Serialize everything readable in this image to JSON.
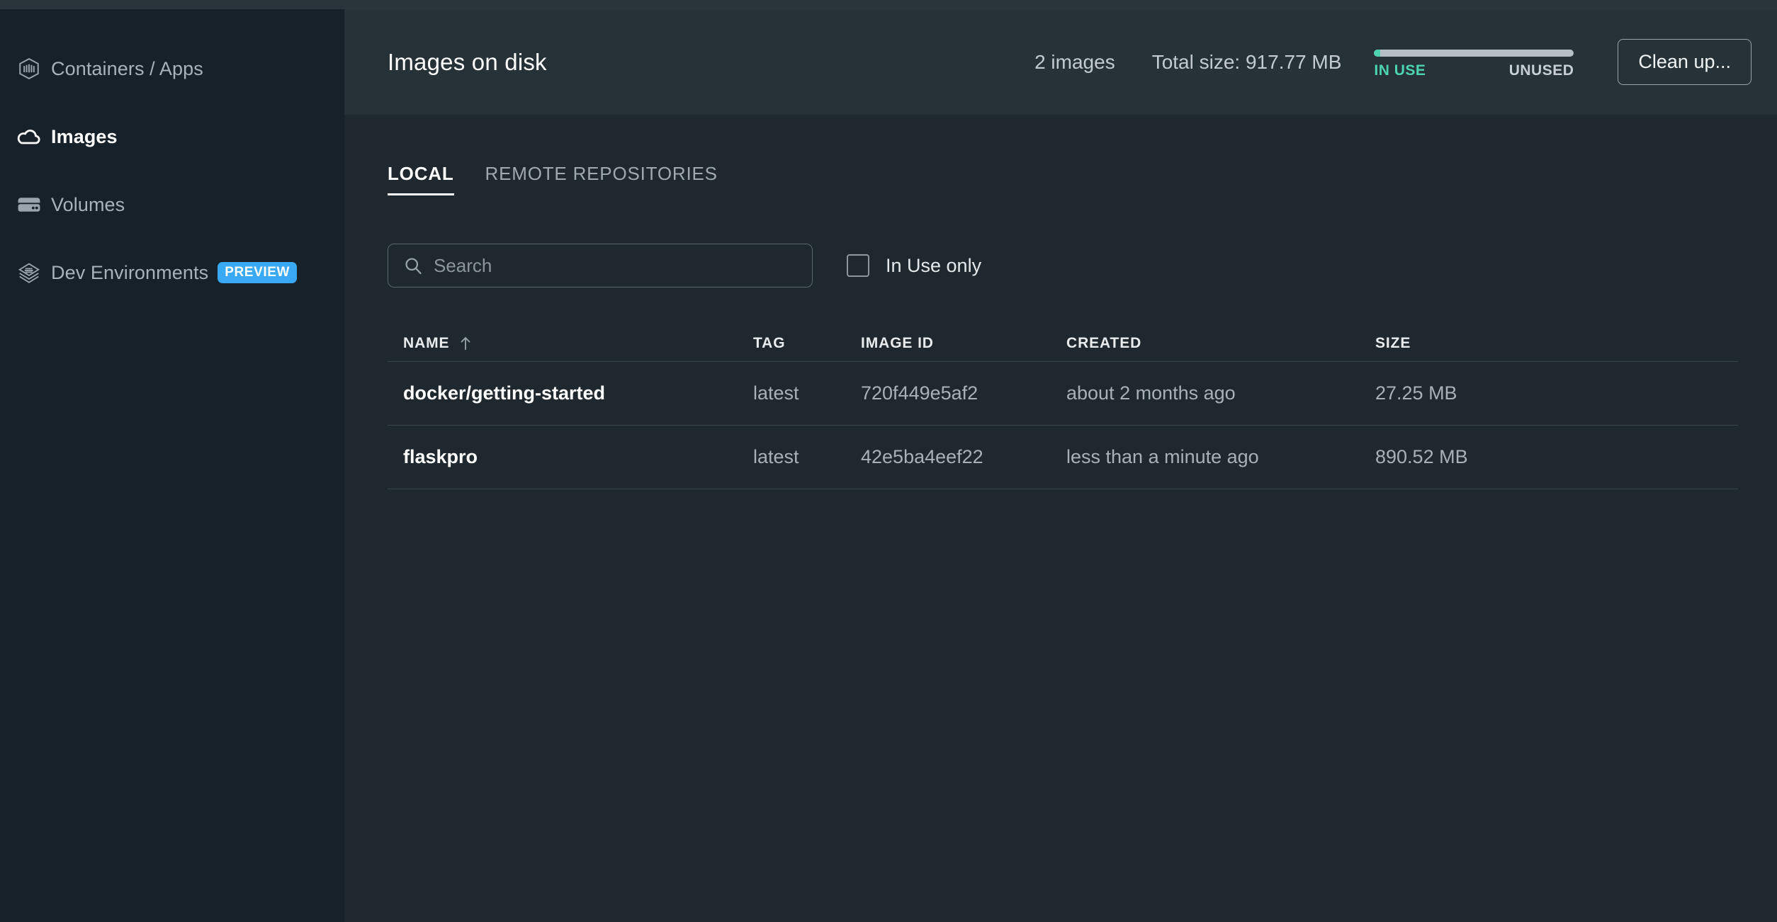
{
  "window": {
    "titlebar_color": "#29353b"
  },
  "sidebar": {
    "items": [
      {
        "label": "Containers / Apps",
        "icon": "container-icon",
        "active": false,
        "badge": ""
      },
      {
        "label": "Images",
        "icon": "cloud-icon",
        "active": true,
        "badge": ""
      },
      {
        "label": "Volumes",
        "icon": "volume-icon",
        "active": false,
        "badge": ""
      },
      {
        "label": "Dev Environments",
        "icon": "layers-icon",
        "active": false,
        "badge": "PREVIEW"
      }
    ],
    "badge_color": "#3aa9f5"
  },
  "header": {
    "title": "Images on disk",
    "image_count": "2 images",
    "total_size": "Total size: 917.77 MB",
    "usage": {
      "in_use_label": "IN USE",
      "unused_label": "UNUSED",
      "in_use_color": "#4cd3b0",
      "unused_color": "#b6bfc6",
      "in_use_percent": 2.9
    },
    "cleanup_label": "Clean up..."
  },
  "tabs": [
    {
      "label": "LOCAL",
      "active": true
    },
    {
      "label": "REMOTE REPOSITORIES",
      "active": false
    }
  ],
  "filters": {
    "search_value": "",
    "search_placeholder": "Search",
    "search_icon": "search-icon",
    "in_use_only_label": "In Use only",
    "in_use_only_checked": false
  },
  "table": {
    "columns": [
      {
        "key": "name",
        "label": "NAME",
        "sorted": true,
        "sort_direction": "asc"
      },
      {
        "key": "tag",
        "label": "TAG",
        "sorted": false
      },
      {
        "key": "id",
        "label": "IMAGE ID",
        "sorted": false
      },
      {
        "key": "created",
        "label": "CREATED",
        "sorted": false
      },
      {
        "key": "size",
        "label": "SIZE",
        "sorted": false
      }
    ],
    "rows": [
      {
        "name": "docker/getting-started",
        "tag": "latest",
        "id": "720f449e5af2",
        "created": "about 2 months ago",
        "size": "27.25 MB"
      },
      {
        "name": "flaskpro",
        "tag": "latest",
        "id": "42e5ba4eef22",
        "created": "less than a minute ago",
        "size": "890.52 MB"
      }
    ]
  }
}
